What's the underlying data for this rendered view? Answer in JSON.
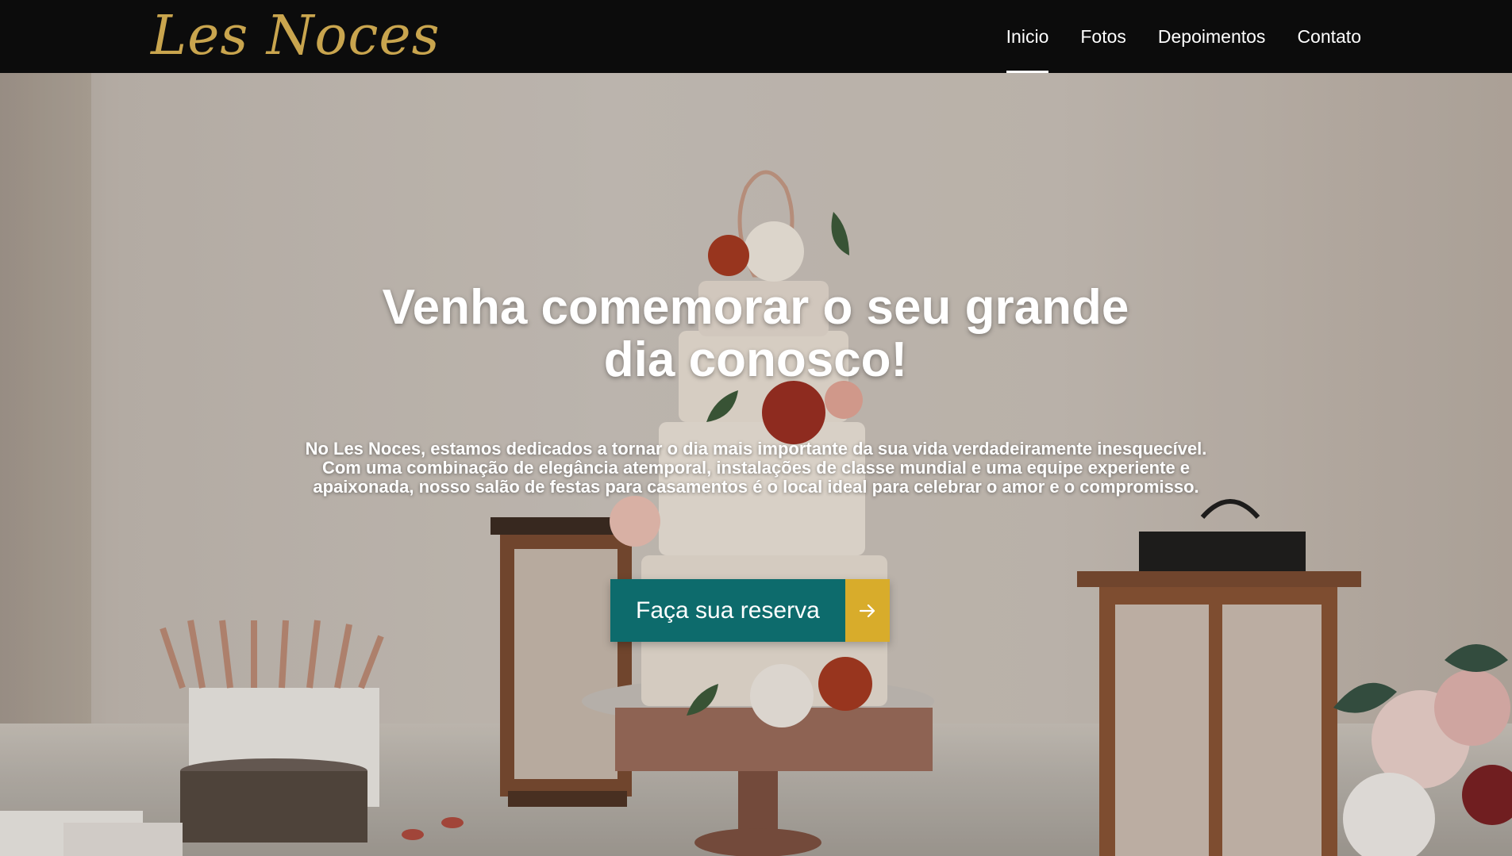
{
  "brand": {
    "logo_text": "Les Noces",
    "logo_color": "#c9a54e"
  },
  "nav": {
    "items": [
      {
        "label": "Inicio",
        "active": true
      },
      {
        "label": "Fotos",
        "active": false
      },
      {
        "label": "Depoimentos",
        "active": false
      },
      {
        "label": "Contato",
        "active": false
      }
    ]
  },
  "hero": {
    "title": "Venha comemorar o seu grande dia conosco!",
    "description": "No Les Noces, estamos dedicados a tornar o dia mais importante da sua vida verdadeiramente inesquecível. Com uma combinação de elegância atemporal, instalações de classe mundial e uma equipe experiente e apaixonada, nosso salão de festas para casamentos é o local ideal para celebrar o amor e o compromisso.",
    "background_image": "wedding cake with lanterns and flowers",
    "cta": {
      "label": "Faça sua reserva",
      "icon": "arrow-right-icon",
      "primary_color": "#0d6b6c",
      "accent_color": "#d8ac2b"
    }
  }
}
